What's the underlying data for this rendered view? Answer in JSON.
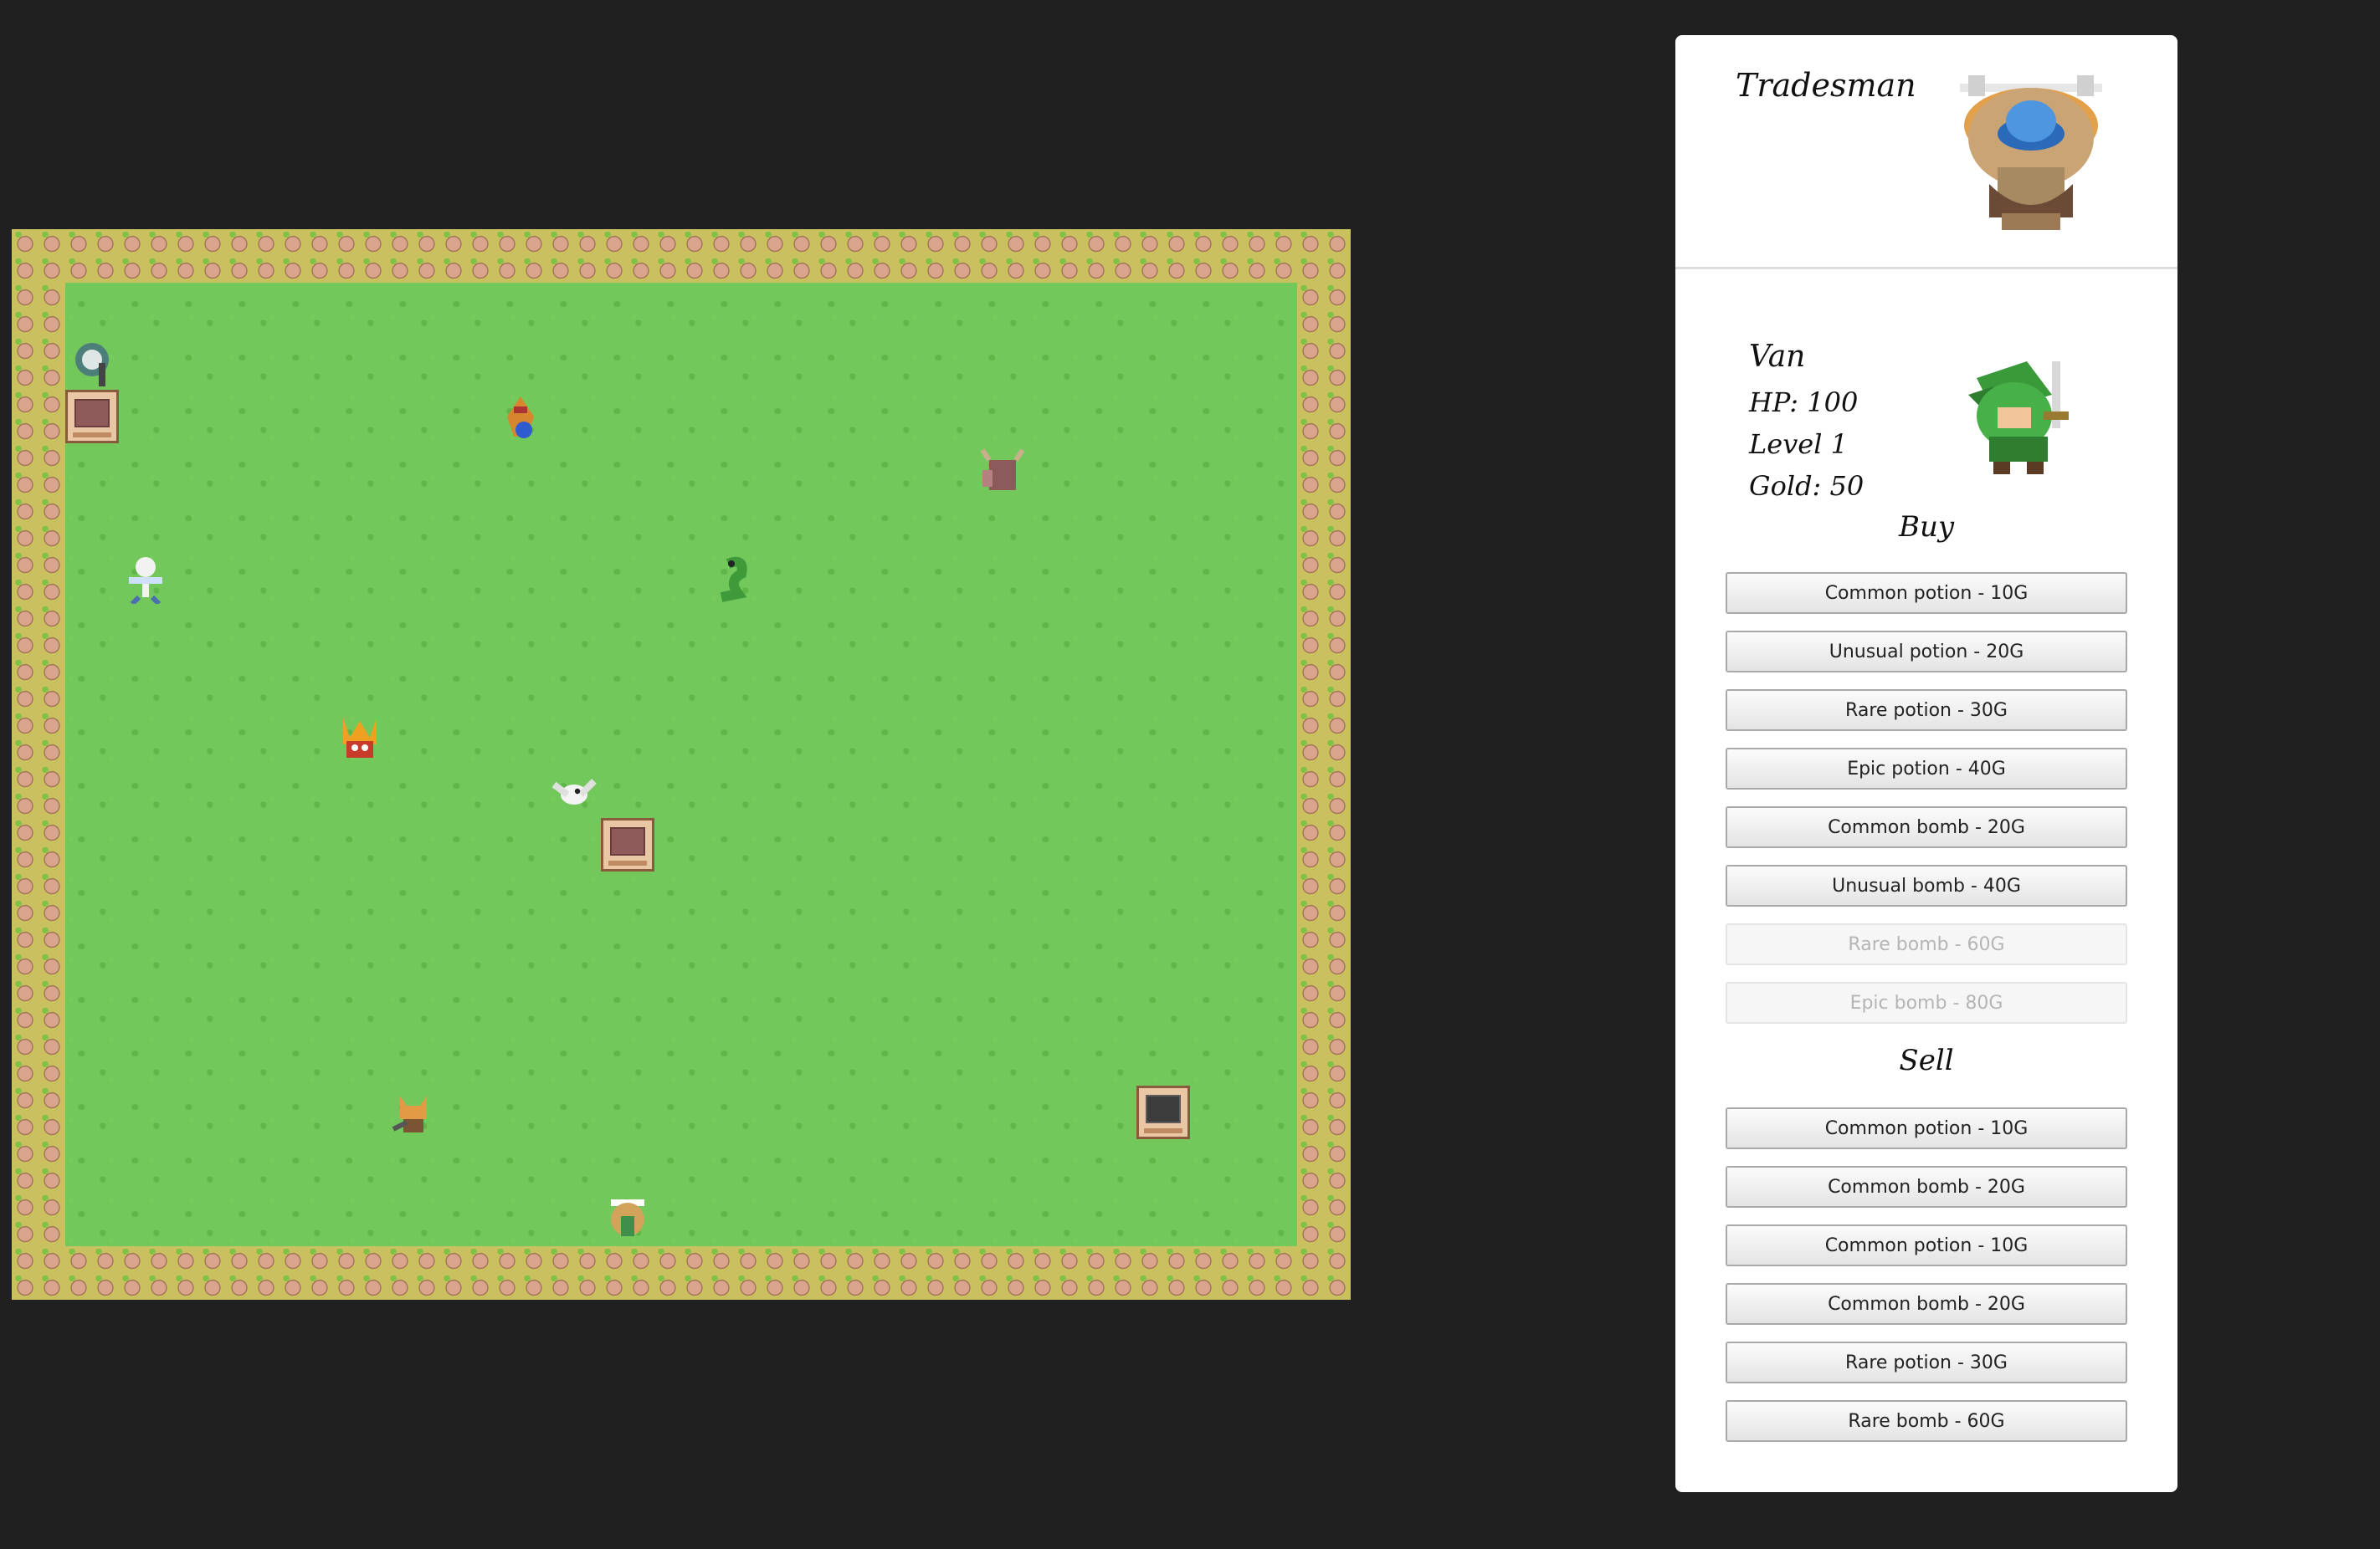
{
  "merchant": {
    "name": "Tradesman",
    "portrait_icon": "tradesman-sprite"
  },
  "player": {
    "name": "Van",
    "hp_text": "HP: 100",
    "level_text": "Level 1",
    "gold_text": "Gold: 50",
    "portrait_icon": "green-hero-sprite"
  },
  "shop": {
    "buy_title": "Buy",
    "sell_title": "Sell",
    "buy_items": [
      {
        "label": "Common potion - 10G",
        "enabled": true
      },
      {
        "label": "Unusual potion - 20G",
        "enabled": true
      },
      {
        "label": "Rare potion - 30G",
        "enabled": true
      },
      {
        "label": "Epic potion - 40G",
        "enabled": true
      },
      {
        "label": "Common bomb - 20G",
        "enabled": true
      },
      {
        "label": "Unusual bomb - 40G",
        "enabled": true
      },
      {
        "label": "Rare bomb - 60G",
        "enabled": false
      },
      {
        "label": "Epic bomb - 80G",
        "enabled": false
      }
    ],
    "sell_items": [
      {
        "label": "Common potion - 10G"
      },
      {
        "label": "Common bomb - 20G"
      },
      {
        "label": "Common potion - 10G"
      },
      {
        "label": "Common bomb - 20G"
      },
      {
        "label": "Rare potion - 30G"
      },
      {
        "label": "Rare bomb - 60G"
      }
    ]
  },
  "map": {
    "border": "rocky-flower-border",
    "ground": "grass",
    "entities": [
      "armored-knight-sprite",
      "fire-imp-sprite",
      "minotaur-sprite",
      "skeleton-sprite",
      "green-snake-sprite",
      "red-flame-demon-sprite",
      "white-bird-sprite",
      "fox-warrior-sprite",
      "player-hero-sprite"
    ],
    "chests": [
      "closed-chest",
      "closed-chest",
      "open-chest"
    ]
  }
}
